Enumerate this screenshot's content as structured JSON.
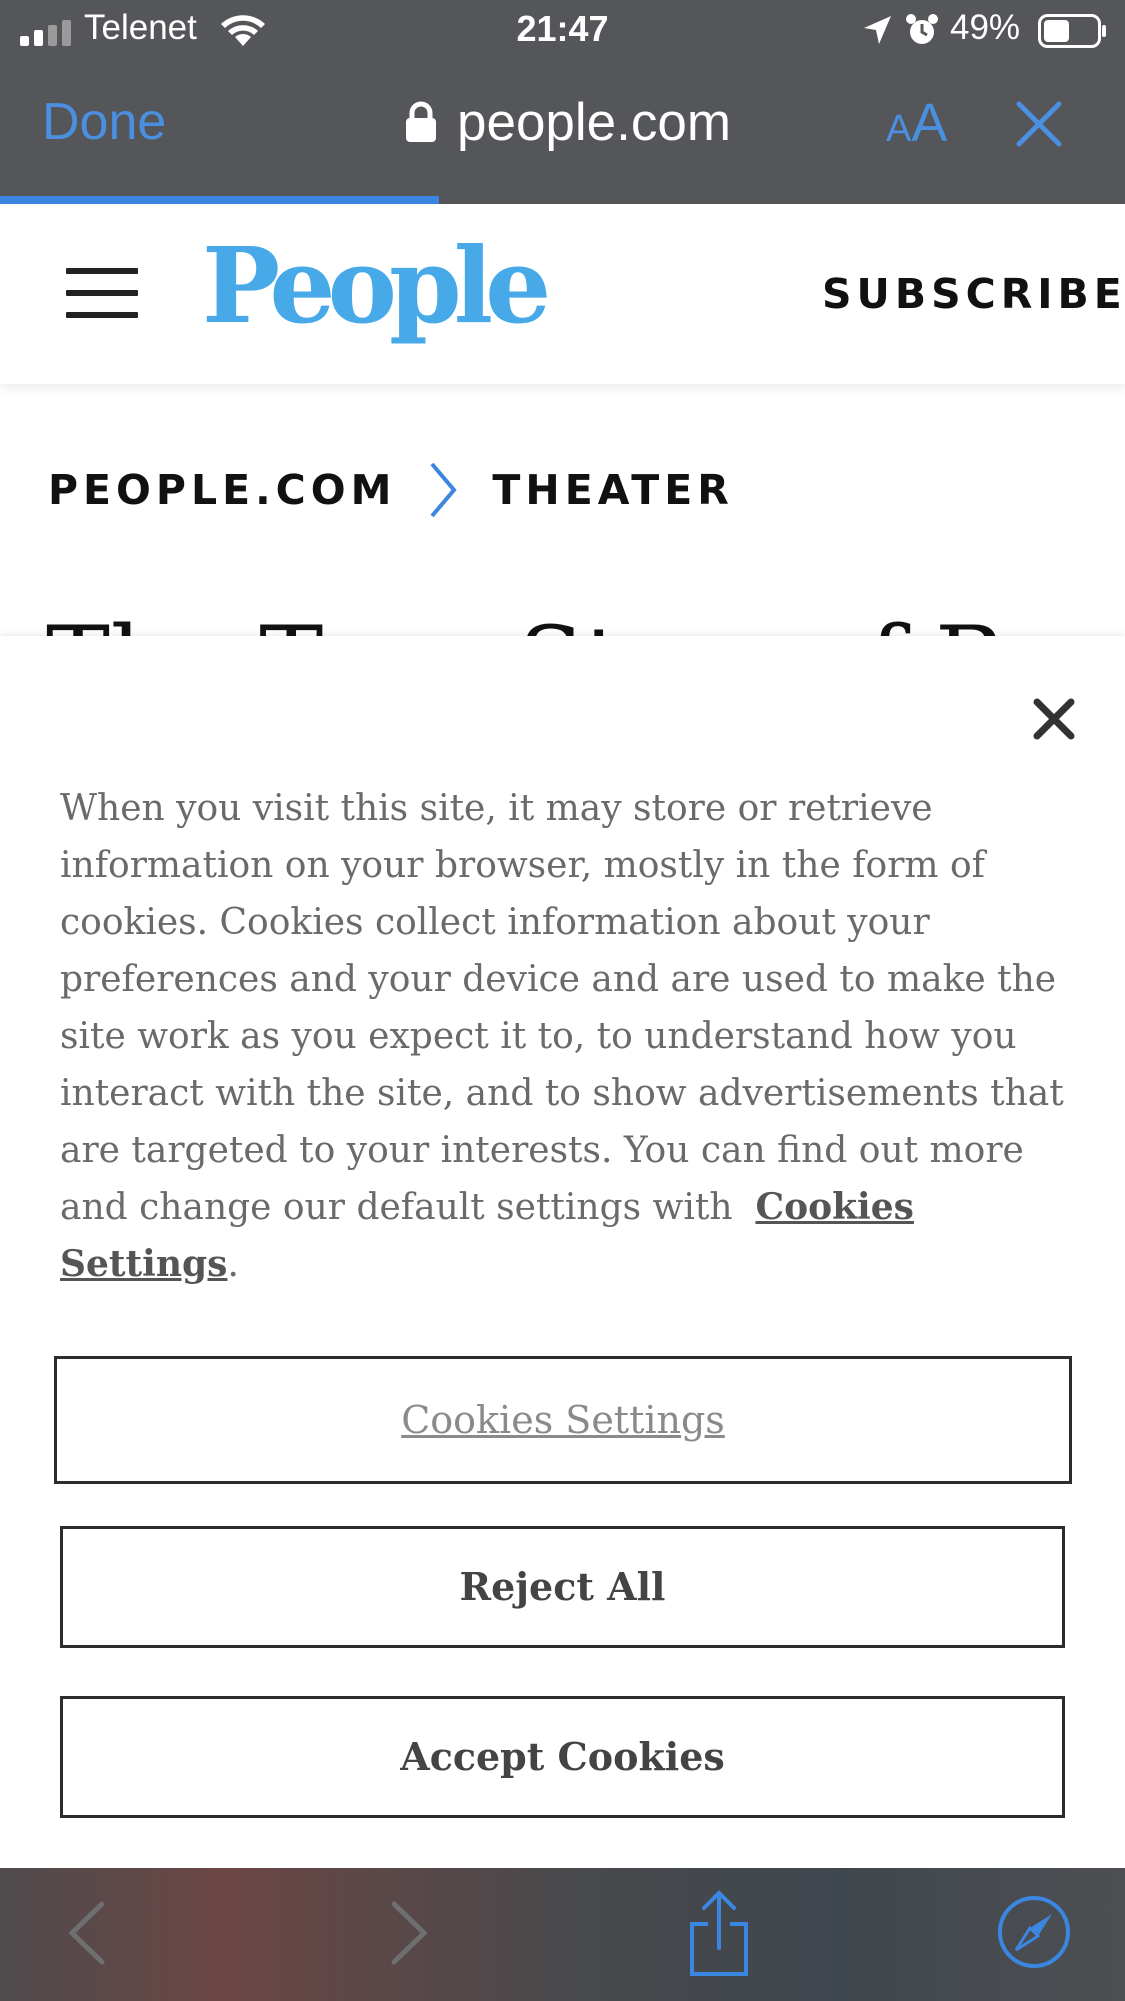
{
  "status_bar": {
    "carrier": "Telenet",
    "time": "21:47",
    "battery_percent": "49%",
    "battery_level": 0.49
  },
  "browser": {
    "done_label": "Done",
    "url": "people.com",
    "text_size_small": "A",
    "text_size_large": "A",
    "load_progress": 0.39,
    "accent_color": "#4a8fe0"
  },
  "site": {
    "logo": "People",
    "subscribe_label": "SUBSCRIBE",
    "brand_color": "#47a9e8"
  },
  "breadcrumb": {
    "items": [
      "PEOPLE.COM",
      "THEATER"
    ]
  },
  "article": {
    "title_peek": "The True Story of Beauty"
  },
  "cookie_banner": {
    "text": "When you visit this site, it may store or retrieve information on your browser, mostly in the form of cookies. Cookies collect information about your preferences and your device and are used to make the site work as you expect it to, to understand how you interact with the site, and to show advertisements that are targeted to your interests. You can find out more and change our default settings with",
    "link_label": "Cookies Settings",
    "trailing": ".",
    "buttons": {
      "settings": "Cookies Settings",
      "reject": "Reject All",
      "accept": "Accept Cookies"
    }
  },
  "toolbar": {
    "icons": [
      "back-icon",
      "forward-icon",
      "share-icon",
      "compass-icon"
    ]
  }
}
